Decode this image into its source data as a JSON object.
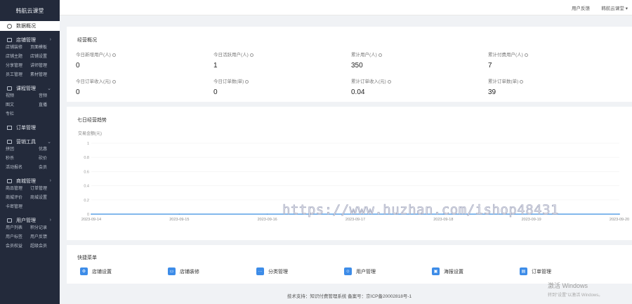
{
  "sidebar": {
    "logo": "韩航云课堂",
    "active_item": "数据概况",
    "groups": [
      {
        "title": "店铺管理",
        "items": [
          "店铺装修",
          "页面模板",
          "店铺主题",
          "店铺设置",
          "分享管理",
          "讲师管理",
          "员工管理",
          "素材管理"
        ]
      },
      {
        "title": "课程管理",
        "items": [
          "视频",
          "音频",
          "图文",
          "直播",
          "专栏"
        ]
      },
      {
        "title": "营销工具",
        "items": [
          "拼团",
          "优惠",
          "秒杀",
          "砍价",
          "活动报名",
          "会员"
        ]
      },
      {
        "title": "商城管理",
        "items": [
          "商品管理",
          "订单管理",
          "商城评价",
          "商城设置",
          "卡密管理"
        ]
      },
      {
        "title": "用户管理",
        "items": [
          "用户列表",
          "积分记录",
          "用户标签",
          "用户反馈",
          "会员权益",
          "超级会员"
        ]
      }
    ],
    "singles": [
      "订单管理"
    ]
  },
  "topbar": {
    "feedback": "用户反馈",
    "user": "韩航云课堂 ▾"
  },
  "overview": {
    "title": "经营概况",
    "stats": [
      {
        "label": "今日新增用户(人)",
        "value": "0"
      },
      {
        "label": "今日活跃用户(人)",
        "value": "1"
      },
      {
        "label": "累计用户(人)",
        "value": "350"
      },
      {
        "label": "累计付费用户(人)",
        "value": "7"
      },
      {
        "label": "今日订单收入(元)",
        "value": "0"
      },
      {
        "label": "今日订单数(单)",
        "value": "0"
      },
      {
        "label": "累计订单收入(元)",
        "value": "0.04"
      },
      {
        "label": "累计订单数(单)",
        "value": "39"
      }
    ]
  },
  "chart_data": {
    "type": "line",
    "title": "七日经营趋势",
    "ylabel": "交易金额(元)",
    "x": [
      "2023-09-14",
      "2023-09-15",
      "2023-09-16",
      "2023-09-17",
      "2023-09-18",
      "2023-09-19",
      "2023-09-20"
    ],
    "yticks": [
      "0",
      "0.2",
      "0.4",
      "0.6",
      "0.8",
      "1"
    ],
    "ylim": [
      0,
      1
    ],
    "series": [
      {
        "values": [
          0,
          0,
          0,
          0,
          0,
          0,
          0
        ],
        "color": "#5aa0e6"
      }
    ],
    "grid": true
  },
  "quick": {
    "title": "快捷菜单",
    "items": [
      {
        "label": "店铺设置",
        "icon": "gear-icon"
      },
      {
        "label": "店铺装修",
        "icon": "palette-icon"
      },
      {
        "label": "分类管理",
        "icon": "more-icon"
      },
      {
        "label": "用户管理",
        "icon": "user-icon"
      },
      {
        "label": "海报设置",
        "icon": "poster-icon"
      },
      {
        "label": "订单管理",
        "icon": "order-icon"
      }
    ]
  },
  "footer": "技术支持：知识付费管理系统  备案号：京ICP备20002818号-1",
  "watermark": "https://www.huzhan.com/ishop48431",
  "activation": {
    "line1": "激活 Windows",
    "line2": "转到\"设置\"以激活 Windows。"
  }
}
